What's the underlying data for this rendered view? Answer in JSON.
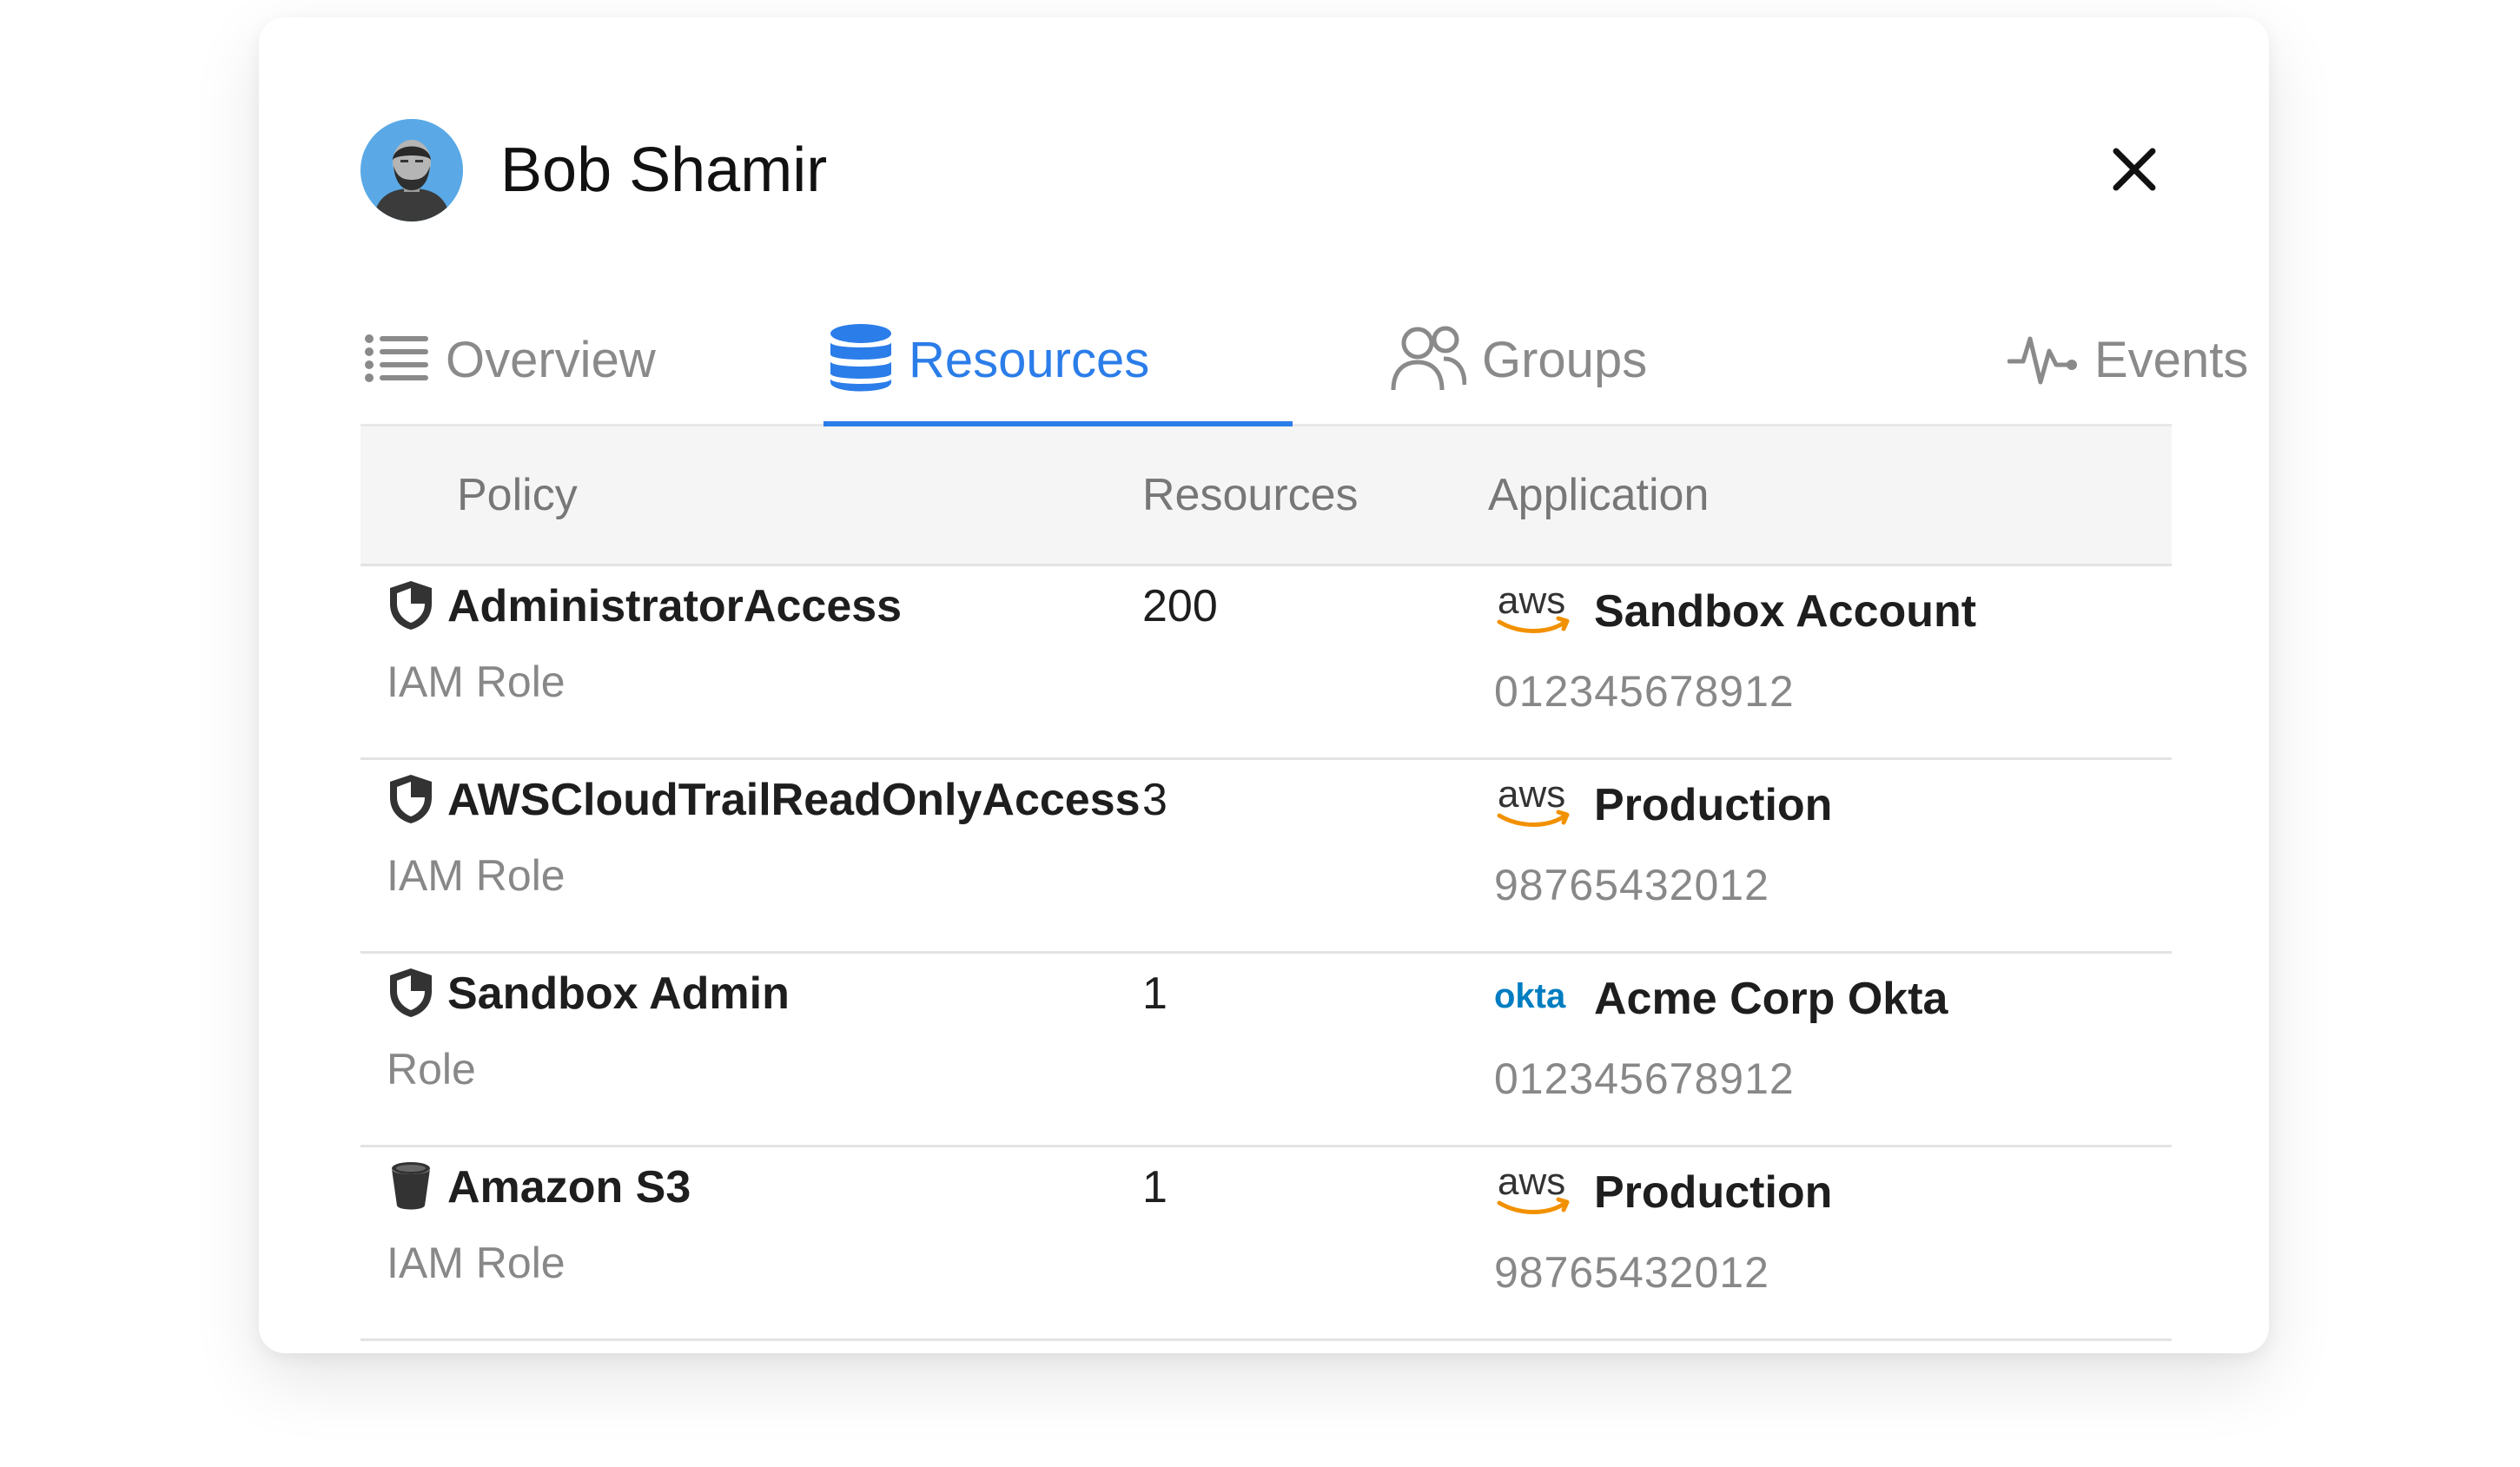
{
  "header": {
    "user_name": "Bob Shamir"
  },
  "tabs": [
    {
      "label": "Overview",
      "icon": "list-icon",
      "active": false
    },
    {
      "label": "Resources",
      "icon": "database-icon",
      "active": true
    },
    {
      "label": "Groups",
      "icon": "users-icon",
      "active": false
    },
    {
      "label": "Events",
      "icon": "activity-icon",
      "active": false
    }
  ],
  "table": {
    "columns": [
      "Policy",
      "Resources",
      "Application"
    ],
    "rows": [
      {
        "policy": "AdministratorAccess",
        "policy_type": "IAM Role",
        "policy_icon": "shield-icon",
        "resources": "200",
        "app_logo": "aws",
        "app_name": "Sandbox Account",
        "app_id": "012345678912"
      },
      {
        "policy": "AWSCloudTrailReadOnlyAccess",
        "policy_type": "IAM Role",
        "policy_icon": "shield-icon",
        "resources": "3",
        "app_logo": "aws",
        "app_name": "Production",
        "app_id": "98765432012"
      },
      {
        "policy": "Sandbox Admin",
        "policy_type": "Role",
        "policy_icon": "shield-icon",
        "resources": "1",
        "app_logo": "okta",
        "app_name": "Acme Corp Okta",
        "app_id": "012345678912"
      },
      {
        "policy": "Amazon S3",
        "policy_type": "IAM Role",
        "policy_icon": "bucket-icon",
        "resources": "1",
        "app_logo": "aws",
        "app_name": "Production",
        "app_id": "98765432012"
      }
    ]
  },
  "logos": {
    "aws_text": "aws",
    "okta_text": "okta"
  },
  "colors": {
    "accent": "#2b7de9",
    "aws_smile": "#f29100",
    "okta_blue": "#007dc1",
    "muted_text": "#888888"
  }
}
